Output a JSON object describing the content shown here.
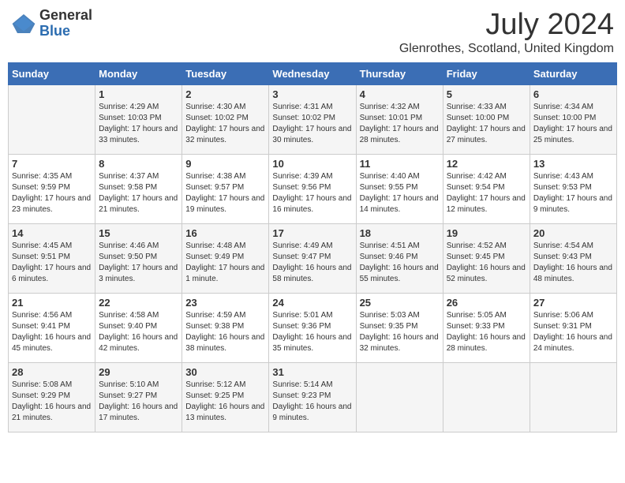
{
  "logo": {
    "general": "General",
    "blue": "Blue"
  },
  "title": "July 2024",
  "location": "Glenrothes, Scotland, United Kingdom",
  "weekdays": [
    "Sunday",
    "Monday",
    "Tuesday",
    "Wednesday",
    "Thursday",
    "Friday",
    "Saturday"
  ],
  "weeks": [
    [
      {
        "day": "",
        "sunrise": "",
        "sunset": "",
        "daylight": ""
      },
      {
        "day": "1",
        "sunrise": "Sunrise: 4:29 AM",
        "sunset": "Sunset: 10:03 PM",
        "daylight": "Daylight: 17 hours and 33 minutes."
      },
      {
        "day": "2",
        "sunrise": "Sunrise: 4:30 AM",
        "sunset": "Sunset: 10:02 PM",
        "daylight": "Daylight: 17 hours and 32 minutes."
      },
      {
        "day": "3",
        "sunrise": "Sunrise: 4:31 AM",
        "sunset": "Sunset: 10:02 PM",
        "daylight": "Daylight: 17 hours and 30 minutes."
      },
      {
        "day": "4",
        "sunrise": "Sunrise: 4:32 AM",
        "sunset": "Sunset: 10:01 PM",
        "daylight": "Daylight: 17 hours and 28 minutes."
      },
      {
        "day": "5",
        "sunrise": "Sunrise: 4:33 AM",
        "sunset": "Sunset: 10:00 PM",
        "daylight": "Daylight: 17 hours and 27 minutes."
      },
      {
        "day": "6",
        "sunrise": "Sunrise: 4:34 AM",
        "sunset": "Sunset: 10:00 PM",
        "daylight": "Daylight: 17 hours and 25 minutes."
      }
    ],
    [
      {
        "day": "7",
        "sunrise": "Sunrise: 4:35 AM",
        "sunset": "Sunset: 9:59 PM",
        "daylight": "Daylight: 17 hours and 23 minutes."
      },
      {
        "day": "8",
        "sunrise": "Sunrise: 4:37 AM",
        "sunset": "Sunset: 9:58 PM",
        "daylight": "Daylight: 17 hours and 21 minutes."
      },
      {
        "day": "9",
        "sunrise": "Sunrise: 4:38 AM",
        "sunset": "Sunset: 9:57 PM",
        "daylight": "Daylight: 17 hours and 19 minutes."
      },
      {
        "day": "10",
        "sunrise": "Sunrise: 4:39 AM",
        "sunset": "Sunset: 9:56 PM",
        "daylight": "Daylight: 17 hours and 16 minutes."
      },
      {
        "day": "11",
        "sunrise": "Sunrise: 4:40 AM",
        "sunset": "Sunset: 9:55 PM",
        "daylight": "Daylight: 17 hours and 14 minutes."
      },
      {
        "day": "12",
        "sunrise": "Sunrise: 4:42 AM",
        "sunset": "Sunset: 9:54 PM",
        "daylight": "Daylight: 17 hours and 12 minutes."
      },
      {
        "day": "13",
        "sunrise": "Sunrise: 4:43 AM",
        "sunset": "Sunset: 9:53 PM",
        "daylight": "Daylight: 17 hours and 9 minutes."
      }
    ],
    [
      {
        "day": "14",
        "sunrise": "Sunrise: 4:45 AM",
        "sunset": "Sunset: 9:51 PM",
        "daylight": "Daylight: 17 hours and 6 minutes."
      },
      {
        "day": "15",
        "sunrise": "Sunrise: 4:46 AM",
        "sunset": "Sunset: 9:50 PM",
        "daylight": "Daylight: 17 hours and 3 minutes."
      },
      {
        "day": "16",
        "sunrise": "Sunrise: 4:48 AM",
        "sunset": "Sunset: 9:49 PM",
        "daylight": "Daylight: 17 hours and 1 minute."
      },
      {
        "day": "17",
        "sunrise": "Sunrise: 4:49 AM",
        "sunset": "Sunset: 9:47 PM",
        "daylight": "Daylight: 16 hours and 58 minutes."
      },
      {
        "day": "18",
        "sunrise": "Sunrise: 4:51 AM",
        "sunset": "Sunset: 9:46 PM",
        "daylight": "Daylight: 16 hours and 55 minutes."
      },
      {
        "day": "19",
        "sunrise": "Sunrise: 4:52 AM",
        "sunset": "Sunset: 9:45 PM",
        "daylight": "Daylight: 16 hours and 52 minutes."
      },
      {
        "day": "20",
        "sunrise": "Sunrise: 4:54 AM",
        "sunset": "Sunset: 9:43 PM",
        "daylight": "Daylight: 16 hours and 48 minutes."
      }
    ],
    [
      {
        "day": "21",
        "sunrise": "Sunrise: 4:56 AM",
        "sunset": "Sunset: 9:41 PM",
        "daylight": "Daylight: 16 hours and 45 minutes."
      },
      {
        "day": "22",
        "sunrise": "Sunrise: 4:58 AM",
        "sunset": "Sunset: 9:40 PM",
        "daylight": "Daylight: 16 hours and 42 minutes."
      },
      {
        "day": "23",
        "sunrise": "Sunrise: 4:59 AM",
        "sunset": "Sunset: 9:38 PM",
        "daylight": "Daylight: 16 hours and 38 minutes."
      },
      {
        "day": "24",
        "sunrise": "Sunrise: 5:01 AM",
        "sunset": "Sunset: 9:36 PM",
        "daylight": "Daylight: 16 hours and 35 minutes."
      },
      {
        "day": "25",
        "sunrise": "Sunrise: 5:03 AM",
        "sunset": "Sunset: 9:35 PM",
        "daylight": "Daylight: 16 hours and 32 minutes."
      },
      {
        "day": "26",
        "sunrise": "Sunrise: 5:05 AM",
        "sunset": "Sunset: 9:33 PM",
        "daylight": "Daylight: 16 hours and 28 minutes."
      },
      {
        "day": "27",
        "sunrise": "Sunrise: 5:06 AM",
        "sunset": "Sunset: 9:31 PM",
        "daylight": "Daylight: 16 hours and 24 minutes."
      }
    ],
    [
      {
        "day": "28",
        "sunrise": "Sunrise: 5:08 AM",
        "sunset": "Sunset: 9:29 PM",
        "daylight": "Daylight: 16 hours and 21 minutes."
      },
      {
        "day": "29",
        "sunrise": "Sunrise: 5:10 AM",
        "sunset": "Sunset: 9:27 PM",
        "daylight": "Daylight: 16 hours and 17 minutes."
      },
      {
        "day": "30",
        "sunrise": "Sunrise: 5:12 AM",
        "sunset": "Sunset: 9:25 PM",
        "daylight": "Daylight: 16 hours and 13 minutes."
      },
      {
        "day": "31",
        "sunrise": "Sunrise: 5:14 AM",
        "sunset": "Sunset: 9:23 PM",
        "daylight": "Daylight: 16 hours and 9 minutes."
      },
      {
        "day": "",
        "sunrise": "",
        "sunset": "",
        "daylight": ""
      },
      {
        "day": "",
        "sunrise": "",
        "sunset": "",
        "daylight": ""
      },
      {
        "day": "",
        "sunrise": "",
        "sunset": "",
        "daylight": ""
      }
    ]
  ]
}
